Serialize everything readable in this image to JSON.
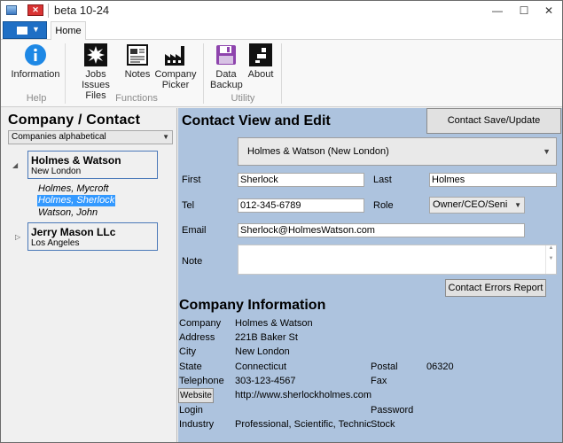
{
  "window": {
    "title": "beta 10-24"
  },
  "ribbon": {
    "tab_home": "Home",
    "buttons": {
      "information": "Information",
      "jobs_line1": "Jobs",
      "jobs_line2": "Issues Files",
      "notes": "Notes",
      "company_line1": "Company",
      "company_line2": "Picker",
      "data_line1": "Data",
      "data_line2": "Backup",
      "about": "About"
    },
    "groups": {
      "help": "Help",
      "functions": "Functions",
      "utility": "Utility"
    }
  },
  "left": {
    "title": "Company / Contact",
    "sort_value": "Companies alphabetical",
    "companies": [
      {
        "name": "Holmes & Watson",
        "city": "New London"
      },
      {
        "name": "Jerry Mason LLc",
        "city": "Los Angeles"
      }
    ],
    "contacts": [
      "Holmes, Mycroft",
      "Holmes, Sherlock",
      "Watson, John"
    ]
  },
  "contact": {
    "title": "Contact View and Edit",
    "save_label": "Contact Save/Update",
    "company_selected": "Holmes & Watson (New London)",
    "labels": {
      "first": "First",
      "last": "Last",
      "tel": "Tel",
      "role": "Role",
      "email": "Email",
      "note": "Note"
    },
    "first": "Sherlock",
    "last": "Holmes",
    "tel": "012-345-6789",
    "role": "Owner/CEO/Seni",
    "email": "Sherlock@HolmesWatson.com",
    "note": "",
    "errors_label": "Contact Errors Report"
  },
  "company_info": {
    "title": "Company Information",
    "labels": {
      "company": "Company",
      "address": "Address",
      "city": "City",
      "state": "State",
      "postal": "Postal",
      "telephone": "Telephone",
      "fax": "Fax",
      "website": "Website",
      "login": "Login",
      "password": "Password",
      "industry": "Industry",
      "stock": "Stock"
    },
    "company": "Holmes & Watson",
    "address": "221B Baker St",
    "city": "New London",
    "state": "Connecticut",
    "postal": "06320",
    "telephone": "303-123-4567",
    "fax": "",
    "website": "http://www.sherlockholmes.com",
    "login": "",
    "password": "",
    "industry": "Professional, Scientific, Technic",
    "stock": ""
  }
}
